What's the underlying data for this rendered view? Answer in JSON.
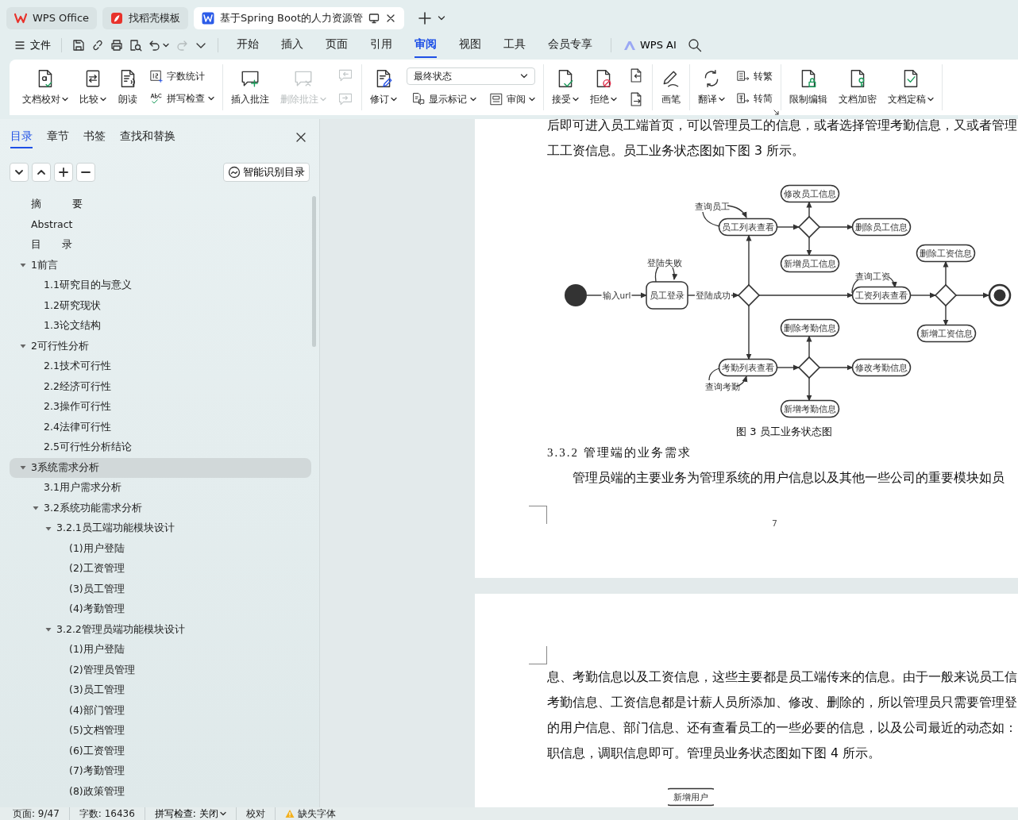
{
  "title_tabs": [
    {
      "label": "WPS Office",
      "selected": false
    },
    {
      "label": "找稻壳模板",
      "selected": false
    },
    {
      "label": "基于Spring Boot的人力资源管",
      "selected": true
    }
  ],
  "menubar": {
    "file_menu": "文件",
    "quick_access": [
      {
        "dropdown": false,
        "disabled": false
      },
      {
        "dropdown": false,
        "disabled": false
      },
      {
        "dropdown": false,
        "disabled": false
      },
      {
        "dropdown": false,
        "disabled": false
      },
      {
        "dropdown": true,
        "disabled": false
      },
      {
        "dropdown": false,
        "disabled": true
      },
      {
        "dropdown": false,
        "disabled": false
      }
    ],
    "tabs": [
      {
        "label": "开始",
        "selected": false
      },
      {
        "label": "插入",
        "selected": false
      },
      {
        "label": "页面",
        "selected": false
      },
      {
        "label": "引用",
        "selected": false
      },
      {
        "label": "审阅",
        "selected": true
      },
      {
        "label": "视图",
        "selected": false
      },
      {
        "label": "工具",
        "selected": false
      },
      {
        "label": "会员专享",
        "selected": false
      }
    ],
    "ai_button": "WPS AI"
  },
  "ribbon": {
    "groups": [
      {
        "items": [
          {
            "kind": "large",
            "label": "文档校对",
            "dropdown": true,
            "disabled": false
          },
          {
            "kind": "large",
            "label": "比较",
            "dropdown": true,
            "disabled": false
          },
          {
            "kind": "large",
            "label": "朗读",
            "dropdown": false,
            "disabled": false
          },
          {
            "kind": "stack",
            "rows": [
              {
                "label": "字数统计",
                "dropdown": false,
                "disabled": false
              },
              {
                "label": "拼写检查",
                "dropdown": true,
                "disabled": false
              }
            ]
          }
        ]
      },
      {
        "items": [
          {
            "kind": "large",
            "label": "插入批注",
            "dropdown": false,
            "disabled": false
          },
          {
            "kind": "large",
            "label": "删除批注",
            "dropdown": true,
            "disabled": true
          },
          {
            "kind": "stack",
            "rows": [
              {
                "dropdown": false,
                "disabled": true
              },
              {
                "dropdown": false,
                "disabled": true
              }
            ]
          }
        ]
      },
      {
        "items": [
          {
            "kind": "large",
            "label": "修订",
            "dropdown": true,
            "disabled": false
          },
          {
            "kind": "mode",
            "value": "最终状态",
            "rows": [
              {
                "label": "显示标记",
                "dropdown": true,
                "disabled": false
              },
              {
                "label": "审阅",
                "dropdown": true,
                "disabled": false
              }
            ]
          }
        ]
      },
      {
        "items": [
          {
            "kind": "large",
            "label": "接受",
            "dropdown": true,
            "disabled": false
          },
          {
            "kind": "large",
            "label": "拒绝",
            "dropdown": true,
            "disabled": false
          },
          {
            "kind": "stack",
            "rows": [
              {
                "dropdown": false,
                "disabled": false
              },
              {
                "dropdown": false,
                "disabled": false
              }
            ]
          }
        ]
      },
      {
        "items": [
          {
            "kind": "large",
            "label": "画笔",
            "dropdown": false,
            "disabled": false
          }
        ]
      },
      {
        "items": [
          {
            "kind": "large",
            "label": "翻译",
            "dropdown": true,
            "disabled": false
          },
          {
            "kind": "stack",
            "rows": [
              {
                "label": "转繁",
                "dropdown": false,
                "disabled": false
              },
              {
                "label": "转简",
                "dropdown": false,
                "disabled": false
              }
            ]
          }
        ]
      },
      {
        "items": [
          {
            "kind": "large",
            "label": "限制编辑",
            "dropdown": false,
            "disabled": false
          },
          {
            "kind": "large",
            "label": "文档加密",
            "dropdown": false,
            "disabled": false
          },
          {
            "kind": "large",
            "label": "文档定稿",
            "dropdown": true,
            "disabled": false
          }
        ]
      }
    ]
  },
  "sidebar": {
    "tabs": [
      {
        "label": "目录",
        "selected": true
      },
      {
        "label": "章节",
        "selected": false
      },
      {
        "label": "书签",
        "selected": false
      },
      {
        "label": "查找和替换",
        "selected": false
      }
    ],
    "smart_button": "智能识别目录",
    "outline": [
      {
        "label": "摘　　　要",
        "selected": false
      },
      {
        "label": "Abstract",
        "selected": false
      },
      {
        "label": "目　　录",
        "selected": false
      },
      {
        "label": "1前言",
        "selected": false,
        "expanded": true,
        "children": [
          {
            "label": "1.1研究目的与意义",
            "selected": false
          },
          {
            "label": "1.2研究现状",
            "selected": false
          },
          {
            "label": "1.3论文结构",
            "selected": false
          }
        ]
      },
      {
        "label": "2可行性分析",
        "selected": false,
        "expanded": true,
        "children": [
          {
            "label": "2.1技术可行性",
            "selected": false
          },
          {
            "label": "2.2经济可行性",
            "selected": false
          },
          {
            "label": "2.3操作可行性",
            "selected": false
          },
          {
            "label": "2.4法律可行性",
            "selected": false
          },
          {
            "label": "2.5可行性分析结论",
            "selected": false
          }
        ]
      },
      {
        "label": "3系统需求分析",
        "selected": true,
        "expanded": true,
        "children": [
          {
            "label": "3.1用户需求分析",
            "selected": false
          },
          {
            "label": "3.2系统功能需求分析",
            "selected": false,
            "expanded": true,
            "children": [
              {
                "label": "3.2.1员工端功能模块设计",
                "selected": false,
                "expanded": true,
                "children": [
                  {
                    "label": "(1)用户登陆",
                    "selected": false
                  },
                  {
                    "label": "(2)工资管理",
                    "selected": false
                  },
                  {
                    "label": "(3)员工管理",
                    "selected": false
                  },
                  {
                    "label": "(4)考勤管理",
                    "selected": false
                  }
                ]
              },
              {
                "label": "3.2.2管理员端功能模块设计",
                "selected": false,
                "expanded": true,
                "children": [
                  {
                    "label": "(1)用户登陆",
                    "selected": false
                  },
                  {
                    "label": "(2)管理员管理",
                    "selected": false
                  },
                  {
                    "label": "(3)员工管理",
                    "selected": false
                  },
                  {
                    "label": "(4)部门管理",
                    "selected": false
                  },
                  {
                    "label": "(5)文档管理",
                    "selected": false
                  },
                  {
                    "label": "(6)工资管理",
                    "selected": false
                  },
                  {
                    "label": "(7)考勤管理",
                    "selected": false
                  },
                  {
                    "label": "(8)政策管理",
                    "selected": false
                  }
                ]
              }
            ]
          }
        ]
      }
    ]
  },
  "document": {
    "pages": [
      {
        "lines": [
          "后即可进入员工端首页，可以管理员工的信息，或者选择管理考勤信息，又或者管理",
          "工工资信息。员工业务状态图如下图 3 所示。"
        ],
        "figure": {
          "nodes": [
            {
              "kind": "start"
            },
            {
              "kind": "state",
              "label": "员工登录"
            },
            {
              "kind": "decision"
            },
            {
              "kind": "state",
              "label": "员工列表查看"
            },
            {
              "kind": "state",
              "label": "修改员工信息"
            },
            {
              "kind": "decision"
            },
            {
              "kind": "state",
              "label": "删除员工信息"
            },
            {
              "kind": "state",
              "label": "新增员工信息"
            },
            {
              "kind": "state",
              "label": "工资列表查看"
            },
            {
              "kind": "state",
              "label": "删除工资信息"
            },
            {
              "kind": "decision"
            },
            {
              "kind": "state",
              "label": "新增工资信息"
            },
            {
              "kind": "end"
            },
            {
              "kind": "state",
              "label": "考勤列表查看"
            },
            {
              "kind": "decision"
            },
            {
              "kind": "state",
              "label": "删除考勤信息"
            },
            {
              "kind": "state",
              "label": "修改考勤信息"
            },
            {
              "kind": "state",
              "label": "新增考勤信息"
            }
          ],
          "edge_labels": [
            "输入url",
            "登陆成功",
            "登陆失败",
            "查询员工",
            "查询工资",
            "查询考勤"
          ]
        },
        "caption": "图 3  员工业务状态图",
        "heading": "3.3.2 管理端的业务需求",
        "paragraph": "管理员端的主要业务为管理系统的用户信息以及其他一些公司的重要模块如员",
        "page_number": "7"
      },
      {
        "lines": [
          "息、考勤信息以及工资信息，这些主要都是员工端传来的信息。由于一般来说员工信",
          "考勤信息、工资信息都是计薪人员所添加、修改、删除的，所以管理员只需要管理登",
          "的用户信息、部门信息、还有查看员工的一些必要的信息，以及公司最近的动态如：",
          "职信息，调职信息即可。管理员业务状态图如下图 4 所示。"
        ],
        "figure": {
          "nodes": [
            {
              "kind": "state",
              "label": "新增用户"
            }
          ]
        }
      }
    ]
  },
  "status_bar": [
    {
      "kind": "text",
      "label": "页面: 9/47"
    },
    {
      "kind": "text",
      "label": "字数: 16436"
    },
    {
      "kind": "dropdown",
      "label": "拼写检查: 关闭"
    },
    {
      "kind": "text",
      "label": "校对"
    },
    {
      "kind": "warning",
      "label": "缺失字体"
    }
  ]
}
